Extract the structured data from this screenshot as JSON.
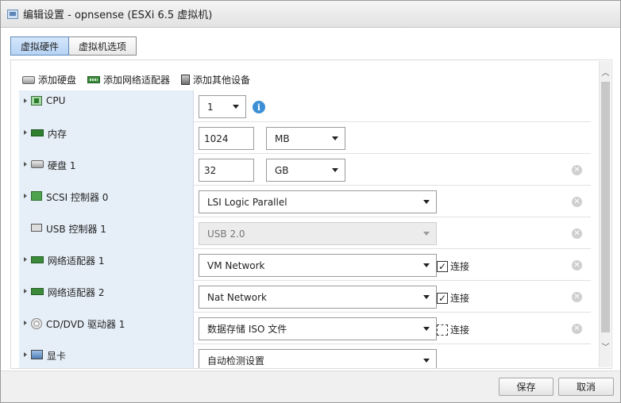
{
  "window": {
    "title": "编辑设置 - opnsense (ESXi 6.5 虚拟机)",
    "icon": "vm-window-icon"
  },
  "tabs": [
    {
      "label": "虚拟硬件",
      "active": true
    },
    {
      "label": "虚拟机选项",
      "active": false
    }
  ],
  "toolbar": {
    "add_disk": "添加硬盘",
    "add_nic": "添加网络适配器",
    "add_other": "添加其他设备"
  },
  "devices": [
    {
      "name": "CPU",
      "icon": "cpu-icon",
      "select": "1",
      "info": "i"
    },
    {
      "name": "内存",
      "icon": "memory-icon",
      "value": "1024",
      "unit": "MB"
    },
    {
      "name": "硬盘 1",
      "icon": "hard-disk-icon",
      "value": "32",
      "unit": "GB",
      "removable": true
    },
    {
      "name": "SCSI 控制器 0",
      "icon": "scsi-controller-icon",
      "select": "LSI Logic Parallel",
      "removable": true
    },
    {
      "name": "USB 控制器 1",
      "icon": "usb-controller-icon",
      "select": "USB 2.0",
      "disabled": true,
      "removable": true
    },
    {
      "name": "网络适配器 1",
      "icon": "network-adapter-icon",
      "select": "VM Network",
      "connect_label": "连接",
      "connected": true,
      "removable": true
    },
    {
      "name": "网络适配器 2",
      "icon": "network-adapter-icon",
      "select": "Nat Network",
      "connect_label": "连接",
      "connected": true,
      "removable": true
    },
    {
      "name": "CD/DVD 驱动器 1",
      "icon": "cd-dvd-icon",
      "select": "数据存储 ISO 文件",
      "connect_label": "连接",
      "connected": false,
      "removable": true
    },
    {
      "name": "显卡",
      "icon": "video-card-icon",
      "select": "自动检测设置"
    }
  ],
  "footer": {
    "save": "保存",
    "cancel": "取消"
  }
}
